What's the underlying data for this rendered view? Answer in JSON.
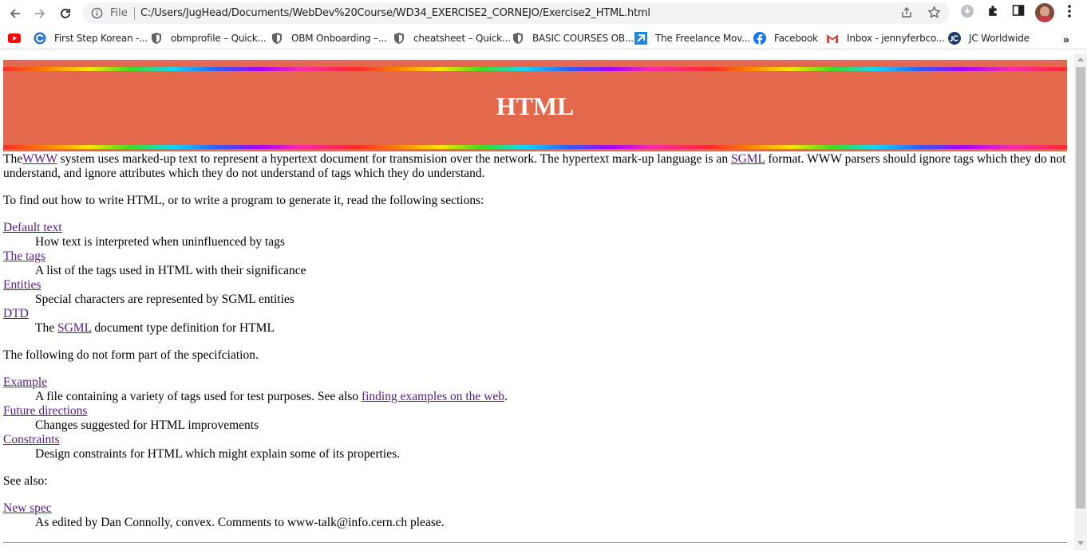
{
  "browser": {
    "file_label": "File",
    "url": "C:/Users/JugHead/Documents/WebDev%20Course/WD34_EXERCISE2_CORNEJO/Exercise2_HTML.html",
    "bookmarks": [
      {
        "label": "",
        "icon": "youtube-icon"
      },
      {
        "label": "First Step Korean -...",
        "icon": "coursera-icon"
      },
      {
        "label": "obmprofile – Quick...",
        "icon": "shield-icon"
      },
      {
        "label": "OBM Onboarding –...",
        "icon": "shield-icon"
      },
      {
        "label": "cheatsheet – Quick...",
        "icon": "shield-icon"
      },
      {
        "label": "BASIC COURSES OB...",
        "icon": "shield-icon"
      },
      {
        "label": "The Freelance Mov...",
        "icon": "freelance-icon"
      },
      {
        "label": "Facebook",
        "icon": "facebook-icon"
      },
      {
        "label": "Inbox - jennyferbco...",
        "icon": "gmail-icon"
      },
      {
        "label": "JC Worldwide",
        "icon": "jc-icon"
      }
    ],
    "more_bookmarks": "»"
  },
  "page": {
    "title": "HTML",
    "intro": {
      "pre": "The",
      "www_link": "WWW",
      "mid": " system uses marked-up text to represent a hypertext document for transmision over the network. The hypertext mark-up language is an ",
      "sgml_link": "SGML",
      "post": " format. WWW parsers should ignore tags which they do not understand, and ignore attributes which they do not understand of tags which they do understand."
    },
    "lead": "To find out how to write HTML, or to write a program to generate it, read the following sections:",
    "sections": [
      {
        "term": "Default text",
        "desc": "How text is interpreted when uninfluenced by tags"
      },
      {
        "term": "The tags",
        "desc": "A list of the tags used in HTML with their significance"
      },
      {
        "term": "Entities",
        "desc": "Special characters are represented by SGML entities"
      }
    ],
    "dtd": {
      "term": "DTD",
      "pre": "The ",
      "link": "SGML",
      "post": " document type definition for HTML"
    },
    "not_spec": "The following do not form part of the specifciation.",
    "example": {
      "term": "Example",
      "pre": "A file containing a variety of tags used for test purposes. See also ",
      "link": "finding examples on the web",
      "post": "."
    },
    "extras": [
      {
        "term": "Future directions",
        "desc": "Changes suggested for HTML improvements"
      },
      {
        "term": "Constraints",
        "desc": "Design constraints for HTML which might explain some of its properties."
      }
    ],
    "see_also": "See also:",
    "new_spec": {
      "term": "New spec",
      "desc": "As edited by Dan Connolly, convex. Comments to www-talk@info.cern.ch please."
    }
  }
}
